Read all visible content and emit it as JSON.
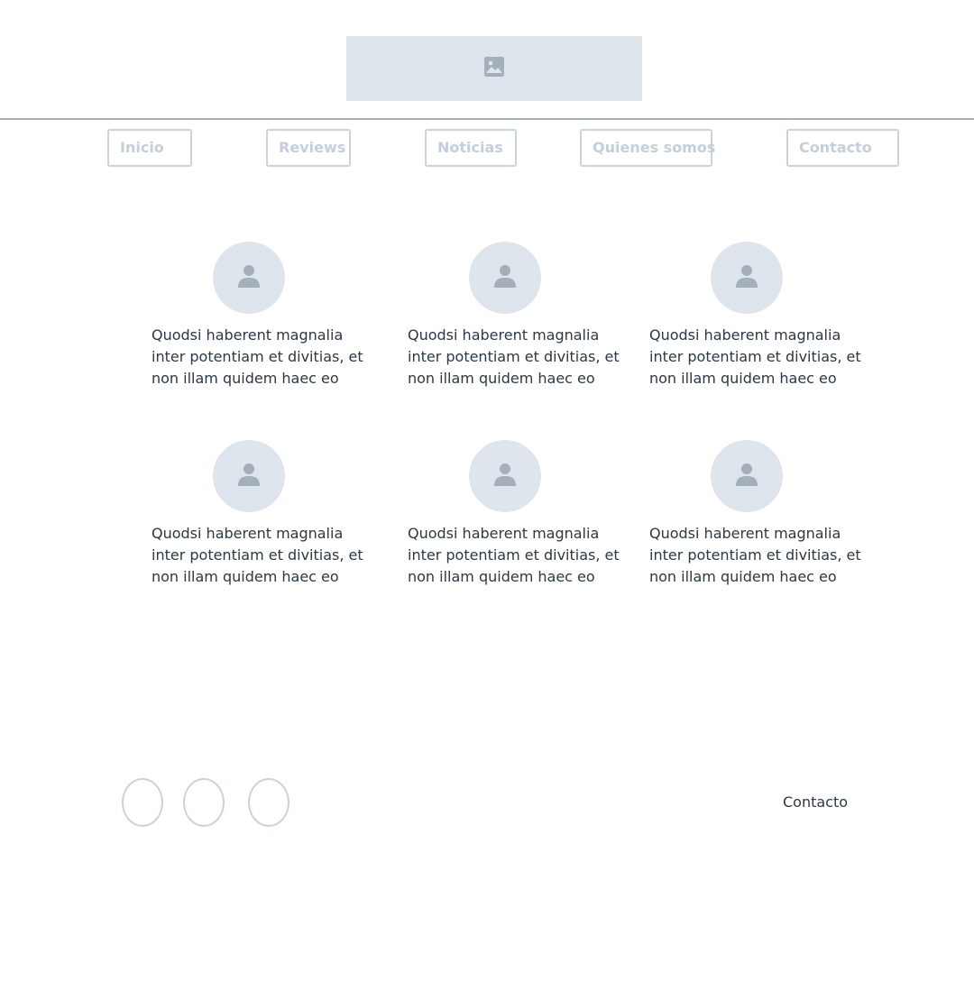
{
  "header": {
    "logo_icon": "image-icon"
  },
  "nav": {
    "items": [
      {
        "label": "Inicio"
      },
      {
        "label": "Reviews"
      },
      {
        "label": "Noticias"
      },
      {
        "label": "Quienes somos"
      },
      {
        "label": "Contacto"
      }
    ]
  },
  "cards": [
    {
      "icon": "user-icon",
      "text": "Quodsi haberent magnalia inter potentiam et divitias, et non illam quidem haec eo"
    },
    {
      "icon": "user-icon",
      "text": "Quodsi haberent magnalia inter potentiam et divitias, et non illam quidem haec eo"
    },
    {
      "icon": "user-icon",
      "text": "Quodsi haberent magnalia inter potentiam et divitias, et non illam quidem haec eo"
    },
    {
      "icon": "user-icon",
      "text": "Quodsi haberent magnalia inter potentiam et divitias, et non illam quidem haec eo"
    },
    {
      "icon": "user-icon",
      "text": "Quodsi haberent magnalia inter potentiam et divitias, et non illam quidem haec eo"
    },
    {
      "icon": "user-icon",
      "text": "Quodsi haberent magnalia inter potentiam et divitias, et non illam quidem haec eo"
    }
  ],
  "footer": {
    "social_count": 3,
    "contact_label": "Contacto"
  },
  "colors": {
    "placeholder_bg": "#dfe5ec",
    "placeholder_icon": "#a3b0bc",
    "border": "#c9d3dd",
    "divider": "#a3b0bc",
    "nav_text": "#c4cfd9",
    "body_text": "#2c3845"
  }
}
